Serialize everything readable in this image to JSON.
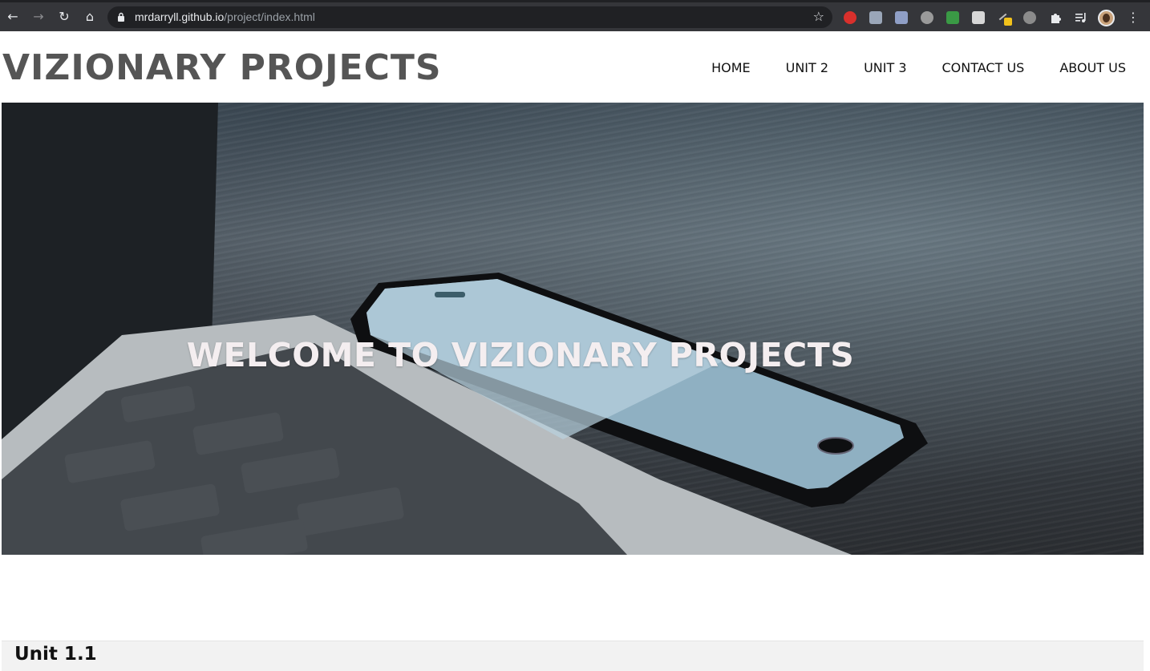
{
  "browser": {
    "back_glyph": "←",
    "forward_glyph": "→",
    "reload_glyph": "↻",
    "home_glyph": "⌂",
    "url_host": "mrdarryll.github.io",
    "url_path": "/project/index.html",
    "star_glyph": "☆",
    "menu_glyph": "⋮",
    "extensions": [
      {
        "icon": "adblock-icon",
        "color": "#d9302c"
      },
      {
        "icon": "code-icon",
        "color": "#9aa6b8"
      },
      {
        "icon": "pi-icon",
        "color": "#8f9fc6"
      },
      {
        "icon": "s-logo-icon",
        "color": "#9a9a9a"
      },
      {
        "icon": "money-icon",
        "color": "#3a9a45"
      },
      {
        "icon": "p-icon",
        "color": "#d7d7d7"
      },
      {
        "icon": "pen-icon",
        "color": "#f2c21b"
      },
      {
        "icon": "globe-icon",
        "color": "#8b8b8b"
      },
      {
        "icon": "puzzle-icon",
        "color": "#e8eaed"
      },
      {
        "icon": "media-playlist-icon",
        "color": "#e8eaed"
      }
    ]
  },
  "site": {
    "title": "VIZIONARY PROJECTS",
    "nav": [
      "HOME",
      "UNIT 2",
      "UNIT 3",
      "CONTACT US",
      "ABOUT US"
    ]
  },
  "hero": {
    "heading": "WELCOME TO VIZIONARY PROJECTS"
  },
  "section": {
    "title": "Unit 1.1"
  }
}
